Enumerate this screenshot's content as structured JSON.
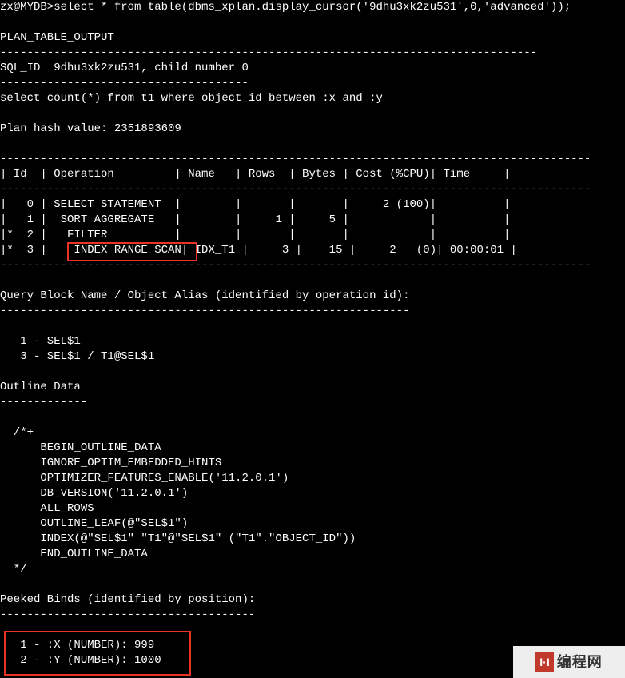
{
  "prompt": "zx@MYDB>select * from table(dbms_xplan.display_cursor('9dhu3xk2zu531',0,'advanced'));",
  "output": {
    "header": "PLAN_TABLE_OUTPUT",
    "dash1": "--------------------------------------------------------------------------------",
    "sqlid": "SQL_ID  9dhu3xk2zu531, child number 0",
    "dash2": "-------------------------------------",
    "sqltext": "select count(*) from t1 where object_id between :x and :y",
    "planhash": "Plan hash value: 2351893609",
    "tabledash": "----------------------------------------------------------------------------------------",
    "tablehdr": "| Id  | Operation         | Name   | Rows  | Bytes | Cost (%CPU)| Time     |",
    "row0": "|   0 | SELECT STATEMENT  |        |       |       |     2 (100)|          |",
    "row1": "|   1 |  SORT AGGREGATE   |        |     1 |     5 |            |          |",
    "row2": "|*  2 |   FILTER          |        |       |       |            |          |",
    "row3": "|*  3 |    INDEX RANGE SCAN| IDX_T1 |     3 |    15 |     2   (0)| 00:00:01 |",
    "qbn_title": "Query Block Name / Object Alias (identified by operation id):",
    "qbn_dash": "-------------------------------------------------------------",
    "qbn1": "   1 - SEL$1",
    "qbn3": "   3 - SEL$1 / T1@SEL$1",
    "outline_title": "Outline Data",
    "outline_dash": "-------------",
    "outl_open": "  /*+",
    "outl1": "      BEGIN_OUTLINE_DATA",
    "outl2": "      IGNORE_OPTIM_EMBEDDED_HINTS",
    "outl3": "      OPTIMIZER_FEATURES_ENABLE('11.2.0.1')",
    "outl4": "      DB_VERSION('11.2.0.1')",
    "outl5": "      ALL_ROWS",
    "outl6": "      OUTLINE_LEAF(@\"SEL$1\")",
    "outl7": "      INDEX(@\"SEL$1\" \"T1\"@\"SEL$1\" (\"T1\".\"OBJECT_ID\"))",
    "outl8": "      END_OUTLINE_DATA",
    "outl_close": "  */",
    "peek_title": "Peeked Binds (identified by position):",
    "peek_dash": "--------------------------------------",
    "bind1": "   1 - :X (NUMBER): 999",
    "bind2": "   2 - :Y (NUMBER): 1000"
  },
  "watermark": {
    "badge": "I·I",
    "text": "编程网"
  }
}
